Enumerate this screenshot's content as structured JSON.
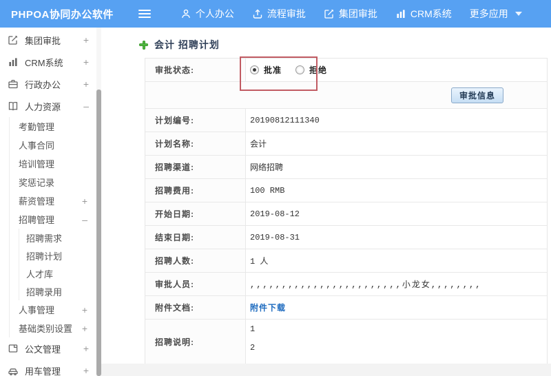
{
  "navbar": {
    "logo": "PHPOA协同办公软件",
    "items": [
      {
        "label": "个人办公",
        "icon": "person-icon"
      },
      {
        "label": "流程审批",
        "icon": "flow-icon"
      },
      {
        "label": "集团审批",
        "icon": "edit-square-icon"
      },
      {
        "label": "CRM系统",
        "icon": "bar-chart-icon"
      },
      {
        "label": "更多应用",
        "icon": "caret-down-icon"
      }
    ]
  },
  "sidebar": {
    "items": [
      {
        "label": "集团审批",
        "icon": "edit-square-icon",
        "expand": "+",
        "level": 0
      },
      {
        "label": "CRM系统",
        "icon": "bar-chart-icon",
        "expand": "+",
        "level": 0
      },
      {
        "label": "行政办公",
        "icon": "briefcase-icon",
        "expand": "+",
        "level": 0
      },
      {
        "label": "人力资源",
        "icon": "book-icon",
        "expand": "–",
        "level": 0
      },
      {
        "label": "考勤管理",
        "level": 1
      },
      {
        "label": "人事合同",
        "level": 1
      },
      {
        "label": "培训管理",
        "level": 1
      },
      {
        "label": "奖惩记录",
        "level": 1
      },
      {
        "label": "薪资管理",
        "expand": "+",
        "level": 1
      },
      {
        "label": "招聘管理",
        "expand": "–",
        "level": 1
      },
      {
        "label": "招聘需求",
        "level": 2
      },
      {
        "label": "招聘计划",
        "level": 2
      },
      {
        "label": "人才库",
        "level": 2
      },
      {
        "label": "招聘录用",
        "level": 2
      },
      {
        "label": "人事管理",
        "expand": "+",
        "level": 1
      },
      {
        "label": "基础类别设置",
        "expand": "+",
        "level": 1
      },
      {
        "label": "公文管理",
        "icon": "document-icon",
        "expand": "+",
        "level": 0
      },
      {
        "label": "用车管理",
        "icon": "car-icon",
        "expand": "+",
        "level": 0
      }
    ]
  },
  "main": {
    "title": "会计 招聘计划",
    "approval": {
      "label": "审批状态:",
      "options": [
        {
          "label": "批准",
          "checked": true
        },
        {
          "label": "拒绝",
          "checked": false
        }
      ],
      "button_label": "审批信息"
    },
    "fields": [
      {
        "label": "计划编号:",
        "value": "20190812111340"
      },
      {
        "label": "计划名称:",
        "value": "会计"
      },
      {
        "label": "招聘渠道:",
        "value": "网络招聘"
      },
      {
        "label": "招聘费用:",
        "value": "100 RMB"
      },
      {
        "label": "开始日期:",
        "value": "2019-08-12"
      },
      {
        "label": "结束日期:",
        "value": "2019-08-31"
      },
      {
        "label": "招聘人数:",
        "value": "1 人"
      },
      {
        "label": "审批人员:",
        "value": ",,,,,,,,,,,,,,,,,,,,,,,,小龙女,,,,,,,,"
      },
      {
        "label": "附件文档:",
        "value": "附件下载",
        "is_link": true
      },
      {
        "label": "招聘说明:",
        "lines": [
          "1",
          "2"
        ]
      }
    ]
  },
  "colors": {
    "navbar_blue": "#57a1f2",
    "annotation_red": "#c15b63",
    "link_blue": "#1e6bbf",
    "plus_green": "#52b943"
  }
}
